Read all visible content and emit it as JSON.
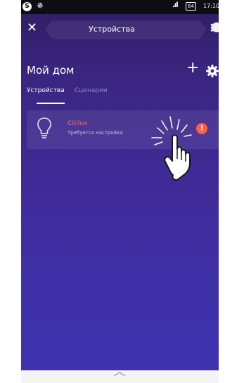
{
  "status_bar": {
    "app_badge": "S",
    "signal": ".ıl",
    "battery": "64",
    "time": "17:10"
  },
  "header": {
    "title": "Устройства",
    "close_icon": "close-icon",
    "menu_icon": "more-vertical-icon"
  },
  "home": {
    "title": "Мой дом",
    "add_label": "+"
  },
  "tabs": [
    {
      "label": "Устройства",
      "active": true
    },
    {
      "label": "Сценарии",
      "active": false
    }
  ],
  "device": {
    "name": "Citilux",
    "status": "Требуется настройка",
    "warning": "!",
    "icon": "bulb-icon"
  },
  "colors": {
    "background": "#3f2a95",
    "device_name": "#ff6b55",
    "warning": "#ff6040"
  }
}
